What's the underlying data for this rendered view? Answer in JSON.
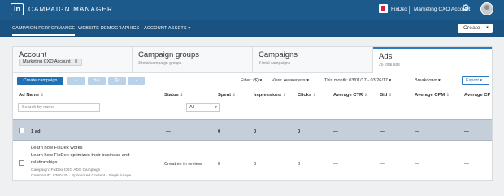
{
  "topbar": {
    "logo_text": "in",
    "app_title": "CAMPAIGN MANAGER",
    "brand_account": "FixDex",
    "active_account": "Marketing CXO Account",
    "icons": [
      "linkedin-logo-icon",
      "account-switch-icon",
      "gear-icon",
      "avatar"
    ]
  },
  "nav": {
    "items": [
      {
        "label": "CAMPAIGN PERFORMANCE",
        "active": true
      },
      {
        "label": "WEBSITE DEMOGRAPHICS",
        "active": false
      },
      {
        "label": "ACCOUNT ASSETS ▾",
        "active": false
      }
    ],
    "create_label": "Create",
    "create_caret": "▾"
  },
  "tabs": [
    {
      "title": "Account",
      "chip": "Marketing CXO Account",
      "chip_close": "✕"
    },
    {
      "title": "Campaign groups",
      "sub": "3 total campaign groups"
    },
    {
      "title": "Campaigns",
      "sub": "8 total campaigns"
    },
    {
      "title": "Ads",
      "sub": "26 total ads",
      "active": true
    }
  ],
  "toolbar": {
    "create_campaign": "Create campaign",
    "filter": "Filter: ($) ▾",
    "view": "View: Awareness ▾",
    "date_range": "This month: 03/01/17 - 03/26/17 ▾",
    "breakdown": "Breakdown ▾",
    "export": "Export ▾"
  },
  "table": {
    "columns": [
      "Ad Name",
      "Status",
      "Spent",
      "Impressions",
      "Clicks",
      "Average CTR",
      "Bid",
      "Average CPM",
      "Average CP"
    ],
    "sort_glyph": "⇕",
    "search_placeholder": "Search by name",
    "status_filter": "All",
    "status_caret": "▾",
    "summary": {
      "name": "1 ad",
      "status": "—",
      "spent": "0",
      "impressions": "0",
      "clicks": "0",
      "ctr": "—",
      "bid": "—",
      "cpm": "—",
      "cpc": "—"
    },
    "rows": [
      {
        "headline": "Learn how FixDex works",
        "text_line1": "Learn how FixDex optimizes their business and",
        "text_line2": "relationships",
        "campaign": "Campaign: FixDex CXO ADS Campaign",
        "creative_info": "Creation ID: #380425 · Sponsored Content · Single image",
        "status": "Creative in review",
        "spent": "0",
        "impressions": "0",
        "clicks": "0",
        "ctr": "—",
        "bid": "—",
        "cpm": "—",
        "cpc": "—"
      }
    ]
  }
}
